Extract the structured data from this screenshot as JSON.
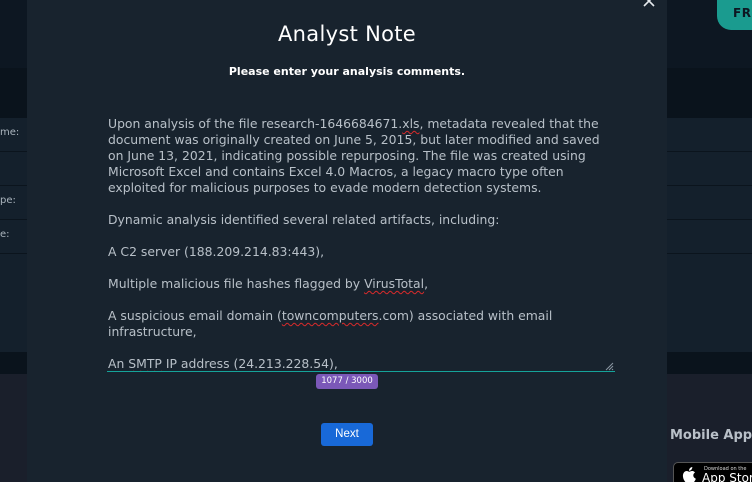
{
  "background": {
    "free_button_label": "FREE",
    "row_labels": [
      "me:",
      "",
      "pe:",
      "e:"
    ],
    "footer": {
      "mobile_app_label": "Mobile App",
      "app_store_small": "Download on the",
      "app_store_big": "App Store"
    }
  },
  "modal": {
    "title": "Analyst Note",
    "subtitle": "Please enter your analysis comments.",
    "close_icon": "close-icon",
    "note": {
      "p1_a": "Upon analysis of the file research-1646684671.",
      "p1_b": "xls",
      "p1_c": ", metadata revealed that the document was originally created on June 5, 2015, but later modified and saved on June 13, 2021, indicating possible repurposing. The file was created using Microsoft Excel and contains Excel 4.0 Macros, a legacy macro type often exploited for malicious purposes to evade modern detection systems.",
      "p2": "Dynamic analysis identified several related artifacts, including:",
      "p3": "A C2 server (188.209.214.83:443),",
      "p4_a": "Multiple malicious file hashes flagged by ",
      "p4_b": "VirusTotal",
      "p4_c": ",",
      "p5_a": "A suspicious email domain (",
      "p5_b": "towncomputers",
      "p5_c": ".com) associated with email infrastructure,",
      "p6_a": "An ",
      "p6_b": "SMTP",
      "p6_c": " IP address (24.213.228.54),"
    },
    "char_counter": "1077 / 3000",
    "next_label": "Next"
  }
}
